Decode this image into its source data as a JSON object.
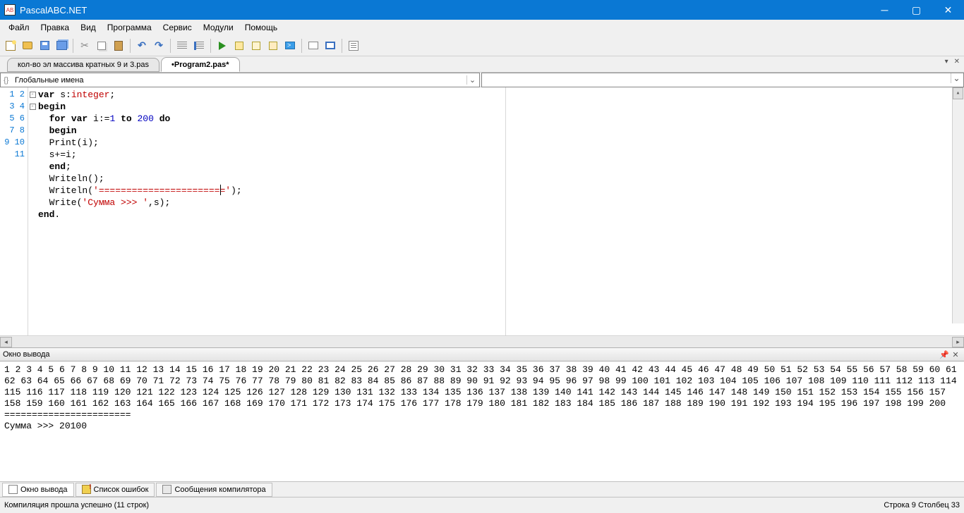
{
  "titlebar": {
    "title": "PascalABC.NET"
  },
  "menu": {
    "file": "Файл",
    "edit": "Правка",
    "view": "Вид",
    "program": "Программа",
    "service": "Сервис",
    "modules": "Модули",
    "help": "Помощь"
  },
  "tabs": {
    "t1": "кол-во эл  массива кратных 9 и 3.pas",
    "t2": "•Program2.pas*"
  },
  "dropdown": {
    "scope": "Глобальные имена"
  },
  "code": {
    "lines": [
      "1",
      "2",
      "3",
      "4",
      "5",
      "6",
      "7",
      "8",
      "9",
      "10",
      "11"
    ],
    "l1a": "var",
    "l1b": " s:",
    "l1c": "integer",
    "l1d": ";",
    "l2a": "begin",
    "l3a": "  for",
    "l3b": " var",
    "l3c": " i:=",
    "l3n1": "1",
    "l3d": " to ",
    "l3n2": "200",
    "l3e": " do",
    "l4a": "  begin",
    "l5a": "  Print(i);",
    "l6a": "  s+=i;",
    "l7a": "  end",
    "l7b": ";",
    "l8a": "  Writeln();",
    "l9a": "  Writeln(",
    "l9s": "'======================='",
    "l9b": ");",
    "l10a": "  Write(",
    "l10s": "'Сумма >>> '",
    "l10b": ",s);",
    "l11a": "end",
    "l11b": "."
  },
  "output": {
    "title": "Окно вывода",
    "text": "1 2 3 4 5 6 7 8 9 10 11 12 13 14 15 16 17 18 19 20 21 22 23 24 25 26 27 28 29 30 31 32 33 34 35 36 37 38 39 40 41 42 43 44 45 46 47 48 49 50 51 52 53 54 55 56 57 58 59 60 61 62 63 64 65 66 67 68 69 70 71 72 73 74 75 76 77 78 79 80 81 82 83 84 85 86 87 88 89 90 91 92 93 94 95 96 97 98 99 100 101 102 103 104 105 106 107 108 109 110 111 112 113 114 115 116 117 118 119 120 121 122 123 124 125 126 127 128 129 130 131 132 133 134 135 136 137 138 139 140 141 142 143 144 145 146 147 148 149 150 151 152 153 154 155 156 157 158 159 160 161 162 163 164 165 166 167 168 169 170 171 172 173 174 175 176 177 178 179 180 181 182 183 184 185 186 187 188 189 190 191 192 193 194 195 196 197 198 199 200 \n=======================\nСумма >>> 20100"
  },
  "bottom_tabs": {
    "t1": "Окно вывода",
    "t2": "Список ошибок",
    "t3": "Сообщения компилятора"
  },
  "status": {
    "left": "Компиляция прошла успешно (11 строк)",
    "right": "Строка  9  Столбец  33"
  }
}
